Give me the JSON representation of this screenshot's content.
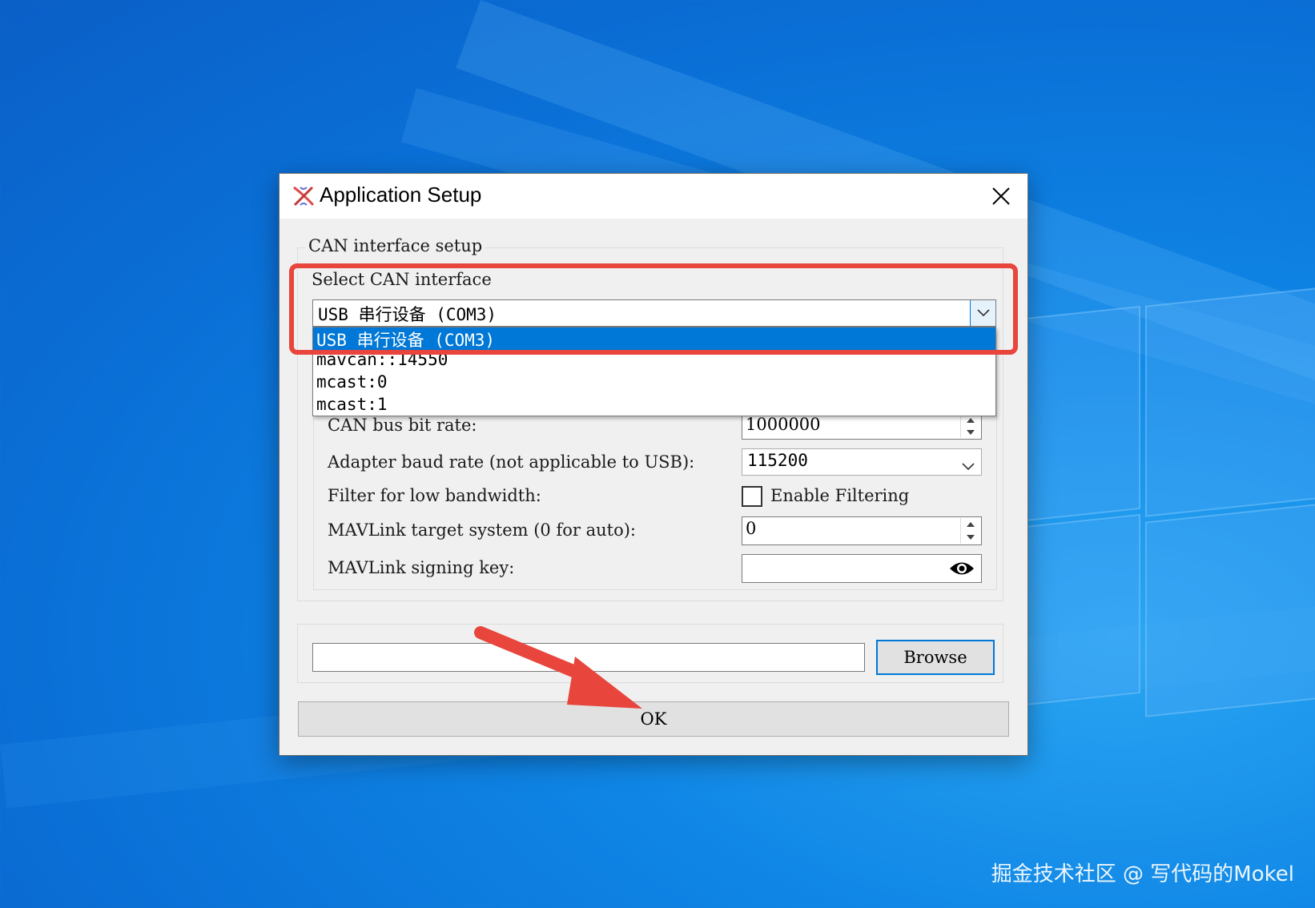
{
  "desktop": {
    "watermark": "掘金技术社区 @ 写代码的Mokel"
  },
  "dialog": {
    "title": "Application Setup",
    "can_group_title": "CAN interface setup",
    "select_label": "Select CAN interface",
    "combo_value": "USB 串行设备 (COM3)",
    "dropdown_items": [
      "USB 串行设备 (COM3)",
      "mavcan::14550",
      "mcast:0",
      "mcast:1"
    ],
    "bitrate_label": "CAN bus bit rate:",
    "bitrate_value": "1000000",
    "baud_label": "Adapter baud rate (not applicable to USB):",
    "baud_value": "115200",
    "filter_label": "Filter for low bandwidth:",
    "filter_checkbox_label": "Enable Filtering",
    "filter_checked": false,
    "target_label": "MAVLink target system (0 for auto):",
    "target_value": "0",
    "signing_label": "MAVLink signing key:",
    "signing_value": "",
    "path_value": "",
    "browse_label": "Browse",
    "ok_label": "OK"
  },
  "annotation": {
    "highlight_color": "#e8453c",
    "arrow_color": "#e8453c"
  }
}
